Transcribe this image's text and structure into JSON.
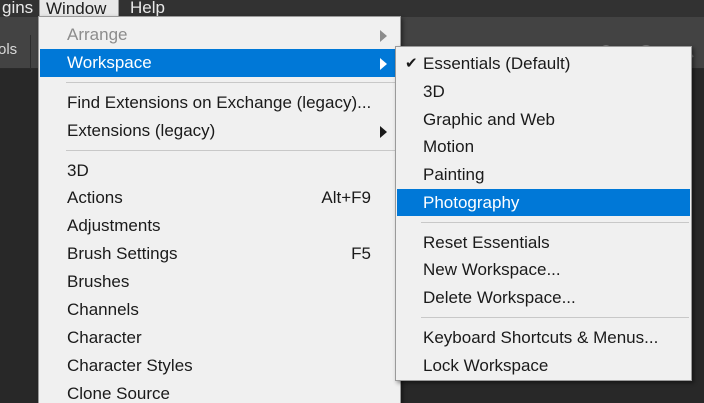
{
  "menubar": {
    "plugins_label": "gins",
    "window_label": "Window",
    "help_label": "Help"
  },
  "optionsbar": {
    "label": "ols"
  },
  "window_menu": {
    "items": [
      {
        "label": "Arrange",
        "shortcut": "",
        "submenu": true,
        "state": "disabled"
      },
      {
        "label": "Workspace",
        "shortcut": "",
        "submenu": true,
        "state": "highlighted"
      },
      {
        "label": "Find Extensions on Exchange (legacy)...",
        "shortcut": "",
        "submenu": false,
        "state": "normal"
      },
      {
        "label": "Extensions (legacy)",
        "shortcut": "",
        "submenu": true,
        "state": "normal"
      },
      {
        "label": "3D",
        "shortcut": "",
        "submenu": false,
        "state": "normal"
      },
      {
        "label": "Actions",
        "shortcut": "Alt+F9",
        "submenu": false,
        "state": "normal"
      },
      {
        "label": "Adjustments",
        "shortcut": "",
        "submenu": false,
        "state": "normal"
      },
      {
        "label": "Brush Settings",
        "shortcut": "F5",
        "submenu": false,
        "state": "normal"
      },
      {
        "label": "Brushes",
        "shortcut": "",
        "submenu": false,
        "state": "normal"
      },
      {
        "label": "Channels",
        "shortcut": "",
        "submenu": false,
        "state": "normal"
      },
      {
        "label": "Character",
        "shortcut": "",
        "submenu": false,
        "state": "normal"
      },
      {
        "label": "Character Styles",
        "shortcut": "",
        "submenu": false,
        "state": "normal"
      },
      {
        "label": "Clone Source",
        "shortcut": "",
        "submenu": false,
        "state": "normal"
      }
    ]
  },
  "workspace_submenu": {
    "items": [
      {
        "label": "Essentials (Default)",
        "checked": true,
        "state": "normal"
      },
      {
        "label": "3D",
        "checked": false,
        "state": "normal"
      },
      {
        "label": "Graphic and Web",
        "checked": false,
        "state": "normal"
      },
      {
        "label": "Motion",
        "checked": false,
        "state": "normal"
      },
      {
        "label": "Painting",
        "checked": false,
        "state": "normal"
      },
      {
        "label": "Photography",
        "checked": false,
        "state": "highlighted"
      },
      {
        "label": "Reset Essentials",
        "checked": false,
        "state": "normal"
      },
      {
        "label": "New Workspace...",
        "checked": false,
        "state": "normal"
      },
      {
        "label": "Delete Workspace...",
        "checked": false,
        "state": "normal"
      },
      {
        "label": "Keyboard Shortcuts & Menus...",
        "checked": false,
        "state": "normal"
      },
      {
        "label": "Lock Workspace",
        "checked": false,
        "state": "normal"
      }
    ],
    "check_glyph": "✔"
  },
  "colors": {
    "highlight": "#0078d7",
    "menu_bg": "#f0f0f0",
    "app_bg": "#282828",
    "toolbar_bg": "#434343"
  }
}
